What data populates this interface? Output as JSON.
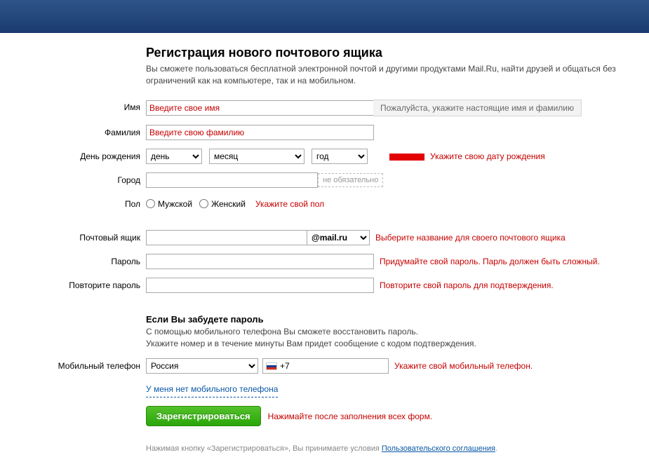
{
  "header": {
    "title": "Регистрация нового почтового ящика",
    "subtitle": "Вы сможете пользоваться бесплатной электронной почтой и другими продуктами Mail.Ru, найти друзей и общаться без ограничений как на компьютере, так и на мобильном."
  },
  "labels": {
    "first_name": "Имя",
    "last_name": "Фамилия",
    "birthday": "День рождения",
    "city": "Город",
    "gender": "Пол",
    "mailbox": "Почтовый ящик",
    "password": "Пароль",
    "password2": "Повторите пароль",
    "phone": "Мобильный телефон"
  },
  "placeholders": {
    "first_name": "Введите свое имя",
    "last_name": "Введите свою фамилию"
  },
  "tips": {
    "name": "Пожалуйста, укажите настоящие имя и фамилию"
  },
  "birthday": {
    "day": "день",
    "month": "месяц",
    "year": "год",
    "error": "Укажите свою дату рождения"
  },
  "city": {
    "optional": "не обязательно"
  },
  "gender": {
    "male": "Мужской",
    "female": "Женский",
    "error": "Укажите свой пол"
  },
  "mailbox": {
    "domain": "@mail.ru",
    "error": "Выберите название для своего почтового ящика"
  },
  "password": {
    "error": "Придумайте свой пароль. Парль должен быть сложный."
  },
  "password2": {
    "error": "Повторите свой пароль для подтверждения."
  },
  "recovery": {
    "heading": "Если Вы забудете пароль",
    "text1": "С помощью мобильного телефона Вы сможете восстановить пароль.",
    "text2": "Укажите номер и в течение минуты Вам придет сообщение с кодом подтверждения."
  },
  "phone": {
    "country": "Россия",
    "code": "+7",
    "error": "Укажите свой мобильный телефон.",
    "no_phone_link": "У меня нет мобильного телефона"
  },
  "submit": {
    "button": "Зарегистрироваться",
    "note": "Нажимайте после заполнения всех форм."
  },
  "agree": {
    "prefix": "Нажимая кнопку «Зарегистрироваться», Вы принимаете условия ",
    "link": "Пользовательского соглашения",
    "suffix": "."
  }
}
